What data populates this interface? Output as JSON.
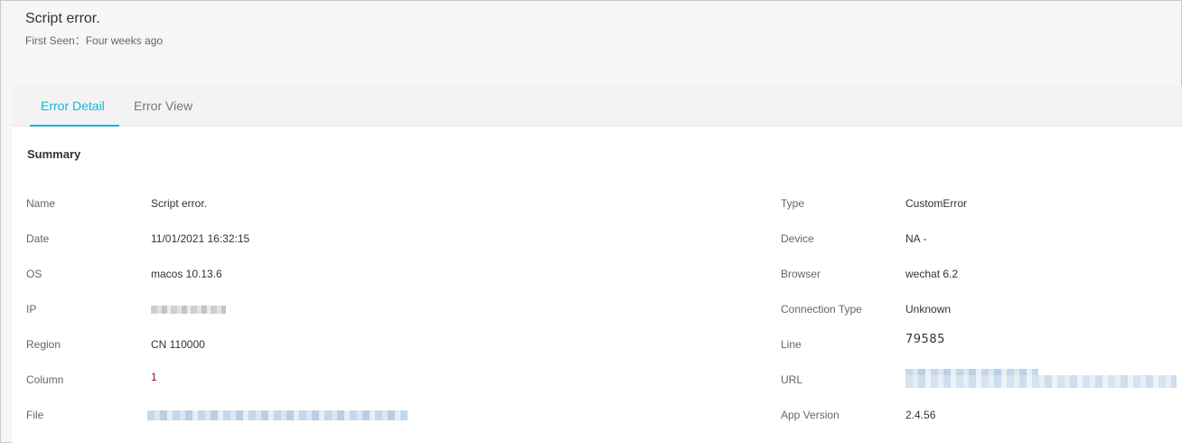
{
  "header": {
    "title": "Script error.",
    "first_seen_label": "First Seen：",
    "first_seen_value": "Four weeks ago"
  },
  "tabs": [
    {
      "label": "Error Detail",
      "active": true
    },
    {
      "label": "Error View",
      "active": false
    }
  ],
  "summary": {
    "heading": "Summary",
    "left": [
      {
        "label": "Name",
        "value": "Script error."
      },
      {
        "label": "Date",
        "value": "11/01/2021 16:32:15"
      },
      {
        "label": "OS",
        "value": "macos 10.13.6"
      },
      {
        "label": "IP",
        "value": ""
      },
      {
        "label": "Region",
        "value": "CN 110000"
      },
      {
        "label": "Column",
        "value": "1"
      },
      {
        "label": "File",
        "value": ""
      }
    ],
    "right": [
      {
        "label": "Type",
        "value": "CustomError"
      },
      {
        "label": "Device",
        "value": "NA -"
      },
      {
        "label": "Browser",
        "value": "wechat 6.2"
      },
      {
        "label": "Connection Type",
        "value": "Unknown"
      },
      {
        "label": "Line",
        "value": "79585"
      },
      {
        "label": "URL",
        "value": ""
      },
      {
        "label": "App Version",
        "value": "2.4.56"
      }
    ]
  },
  "colors": {
    "accent": "#14b8d4",
    "column_value": "#8b1a2b"
  }
}
